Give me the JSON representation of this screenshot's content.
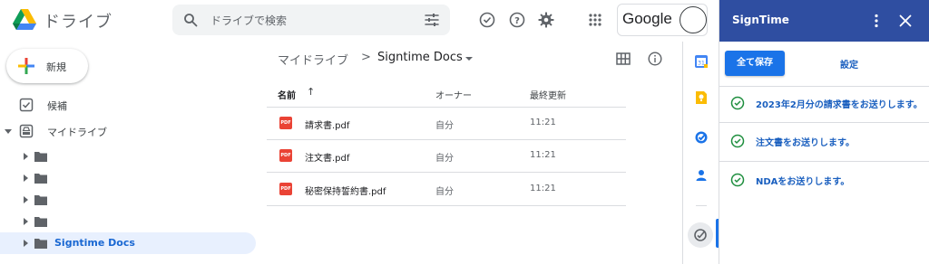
{
  "header": {
    "app_name": "ドライブ",
    "search_placeholder": "ドライブで検索",
    "account_label": "Google"
  },
  "nav": {
    "new_label": "新規",
    "items": [
      {
        "label": "候補",
        "icon": "suggested-check-icon"
      },
      {
        "label": "マイドライブ",
        "icon": "my-drive-icon"
      }
    ],
    "folders": [
      {
        "label": ""
      },
      {
        "label": ""
      },
      {
        "label": ""
      },
      {
        "label": ""
      },
      {
        "label": "Signtime Docs",
        "selected": true
      }
    ]
  },
  "breadcrumb": {
    "root": "マイドライブ",
    "separator": ">",
    "current": "Signtime Docs"
  },
  "file_list": {
    "columns": {
      "name": "名前",
      "sort_arrow": "↑",
      "owner": "オーナー",
      "modified": "最終更新"
    },
    "files": [
      {
        "name": "請求書.pdf",
        "owner": "自分",
        "modified": "11:21",
        "type_badge": "PDF"
      },
      {
        "name": "注文書.pdf",
        "owner": "自分",
        "modified": "11:21",
        "type_badge": "PDF"
      },
      {
        "name": "秘密保持誓約書.pdf",
        "owner": "自分",
        "modified": "11:21",
        "type_badge": "PDF"
      }
    ]
  },
  "panel": {
    "title": "SignTime",
    "save_all_label": "全て保存",
    "settings_label": "設定",
    "messages": [
      {
        "text": "2023年2月分の請求書をお送りします。"
      },
      {
        "text": "注文書をお送りします。"
      },
      {
        "text": "NDAをお送りします。"
      }
    ]
  },
  "colors": {
    "panel_header": "#2f4ea1",
    "primary_blue": "#1a73e8",
    "link_blue": "#1a5fbf",
    "check_green": "#1e8e3e",
    "pdf_red": "#ea4335",
    "selected_bg": "#e8f0fe"
  }
}
